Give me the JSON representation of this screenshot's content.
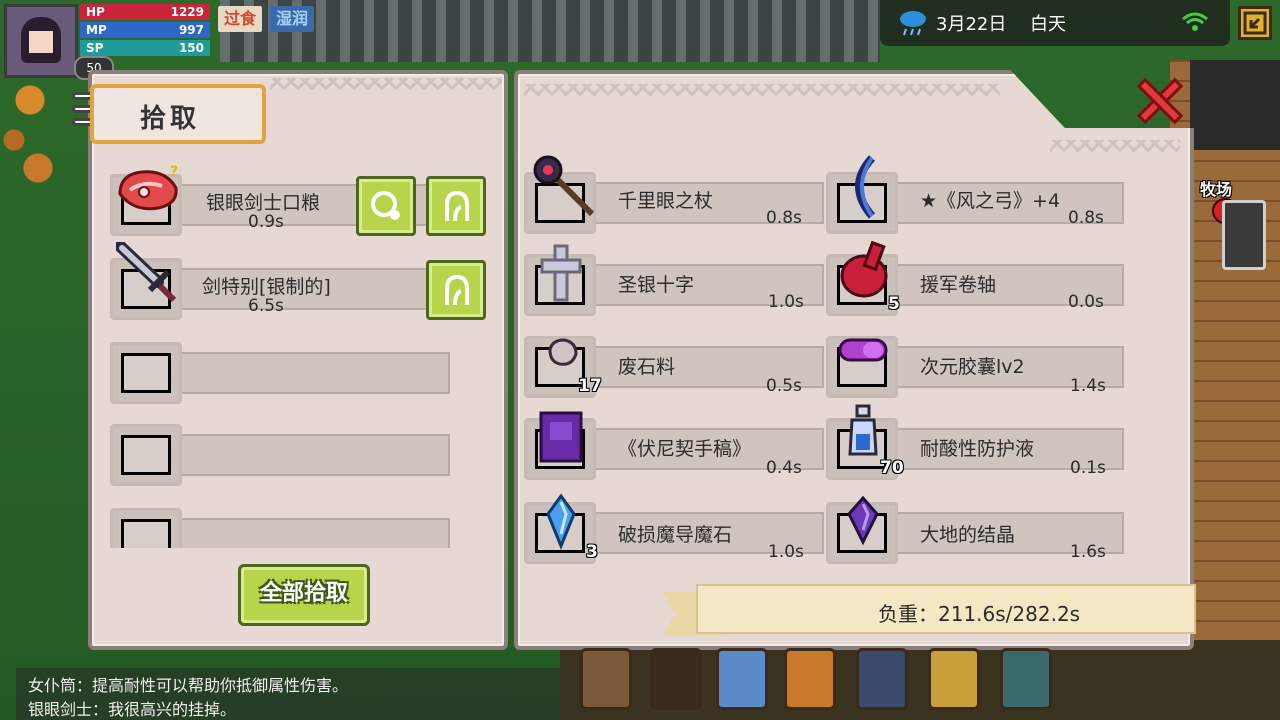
{
  "hud": {
    "hp_label": "HP",
    "hp_value": "1229",
    "mp_label": "MP",
    "mp_value": "997",
    "sp_label": "SP",
    "sp_value": "150",
    "level": "50",
    "status_overfed": "过食",
    "status_wet": "湿润"
  },
  "weather": {
    "date": "3月22日",
    "time_of_day": "白天",
    "icon": "rain-cloud-icon"
  },
  "pickup_panel": {
    "title": "拾取",
    "pick_all_label": "全部拾取",
    "slots": [
      {
        "name": "银眼剑士口粮",
        "weight": "0.9s",
        "icon": "meat-icon"
      },
      {
        "name": "剑特别[银制的]",
        "weight": "6.5s",
        "icon": "sword-icon"
      },
      {
        "name": "",
        "weight": ""
      },
      {
        "name": "",
        "weight": ""
      },
      {
        "name": "",
        "weight": ""
      }
    ]
  },
  "inventory": {
    "left_column": [
      {
        "name": "千里眼之杖",
        "weight": "0.8s",
        "qty": ""
      },
      {
        "name": "圣银十字",
        "weight": "1.0s",
        "qty": ""
      },
      {
        "name": "废石料",
        "weight": "0.5s",
        "qty": "17"
      },
      {
        "name": "《伏尼契手稿》",
        "weight": "0.4s",
        "qty": ""
      },
      {
        "name": "破损魔导魔石",
        "weight": "1.0s",
        "qty": "3"
      }
    ],
    "right_column": [
      {
        "name": "★《风之弓》+4",
        "weight": "0.8s",
        "qty": ""
      },
      {
        "name": "援军卷轴",
        "weight": "0.0s",
        "qty": "5"
      },
      {
        "name": "次元胶囊lv2",
        "weight": "1.4s",
        "qty": ""
      },
      {
        "name": "耐酸性防护液",
        "weight": "0.1s",
        "qty": "70"
      },
      {
        "name": "大地的结晶",
        "weight": "1.6s",
        "qty": ""
      }
    ],
    "load_label": "负重：211.6s/282.2s"
  },
  "map": {
    "ranch_label": "牧场"
  },
  "chat": {
    "line1": "女仆筒：提高耐性可以帮助你抵御属性伤害。",
    "line2": "银眼剑士：我很高兴的挂掉。"
  },
  "colors": {
    "panel_bg": "#e6d9d3",
    "button_green": "#b6d54a",
    "accent_orange": "#e2a43a",
    "close_red": "#e23a3a"
  }
}
